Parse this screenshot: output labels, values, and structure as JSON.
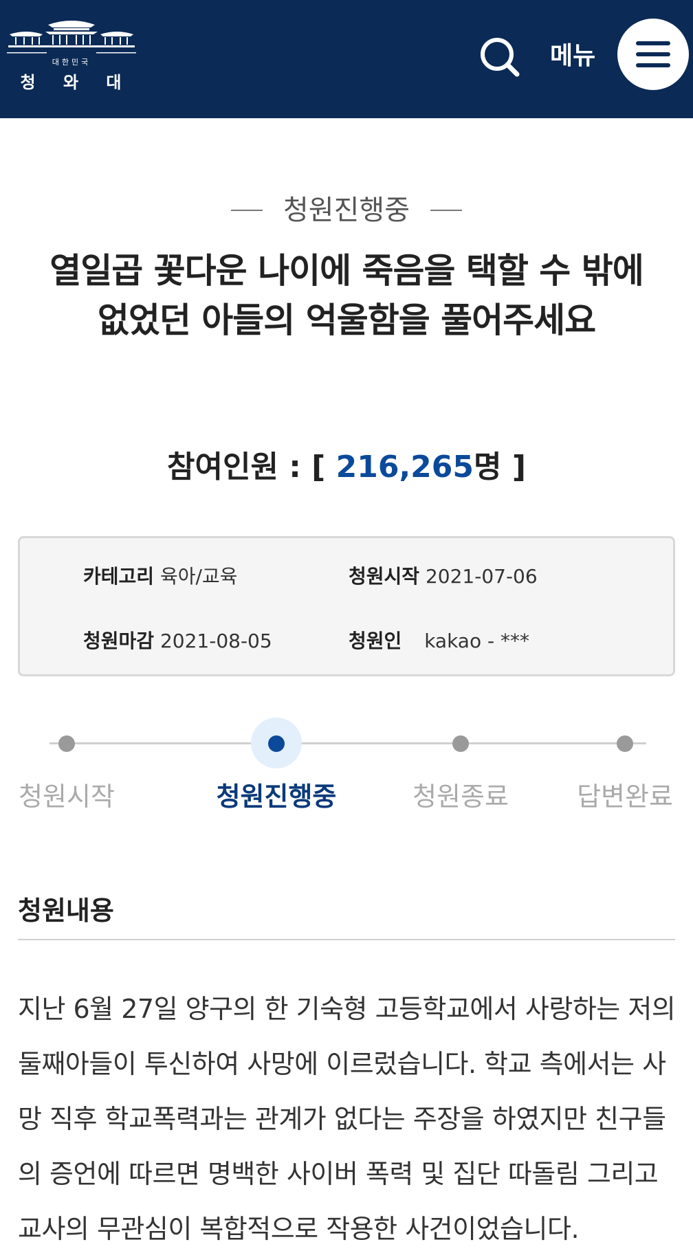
{
  "header": {
    "logo": {
      "country": "대한민국",
      "name": "청 와 대"
    },
    "search_icon": "search-icon",
    "menu_label": "메뉴",
    "menu_icon": "hamburger-icon",
    "bg_color": "#0b2a55"
  },
  "petition": {
    "status": "청원진행중",
    "title": "열일곱 꽃다운 나이에 죽음을 택할 수 밖에 없었던 아들의 억울함을 풀어주세요",
    "participants": {
      "label": "참여인원 : [",
      "count": "216,265",
      "unit": "명 ]"
    },
    "info": {
      "category_label": "카테고리",
      "category": "육아/교육",
      "start_label": "청원시작",
      "start": "2021-07-06",
      "end_label": "청원마감",
      "end": "2021-08-05",
      "author_label": "청원인",
      "author": "kakao - ***"
    }
  },
  "progress": {
    "steps": [
      "청원시작",
      "청원진행중",
      "청원종료",
      "답변완료"
    ],
    "active_index": 1,
    "accent": "#0b4a9a"
  },
  "content": {
    "section_title": "청원내용",
    "body": "지난 6월 27일 양구의 한 기숙형 고등학교에서 사랑하는 저의 둘째아들이 투신하여 사망에 이르렀습니다. 학교 측에서는 사망 직후 학교폭력과는 관계가 없다는 주장을 하였지만 친구들의 증언에 따르면 명백한 사이버 폭력 및 집단 따돌림 그리고 교사의 무관심이 복합적으로 작용한 사건이었습니다."
  }
}
